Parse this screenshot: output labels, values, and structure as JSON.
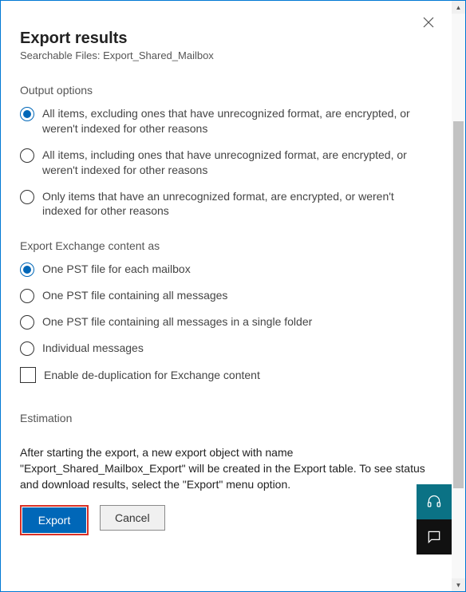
{
  "header": {
    "title": "Export results",
    "subtitle_prefix": "Searchable Files: ",
    "subtitle_name": "Export_Shared_Mailbox"
  },
  "output": {
    "heading": "Output options",
    "options": [
      "All items, excluding ones that have unrecognized format, are encrypted, or weren't indexed for other reasons",
      "All items, including ones that have unrecognized format, are encrypted, or weren't indexed for other reasons",
      "Only items that have an unrecognized format, are encrypted, or weren't indexed for other reasons"
    ],
    "selected_index": 0
  },
  "exchange": {
    "heading": "Export Exchange content as",
    "options": [
      "One PST file for each mailbox",
      "One PST file containing all messages",
      "One PST file containing all messages in a single folder",
      "Individual messages"
    ],
    "selected_index": 0,
    "dedup_label": "Enable de-duplication for Exchange content"
  },
  "estimation": {
    "heading": "Estimation"
  },
  "info_text": "After starting the export, a new export object with name \"Export_Shared_Mailbox_Export\" will be created in the Export table. To see status and download results, select the \"Export\" menu option.",
  "buttons": {
    "export": "Export",
    "cancel": "Cancel"
  }
}
